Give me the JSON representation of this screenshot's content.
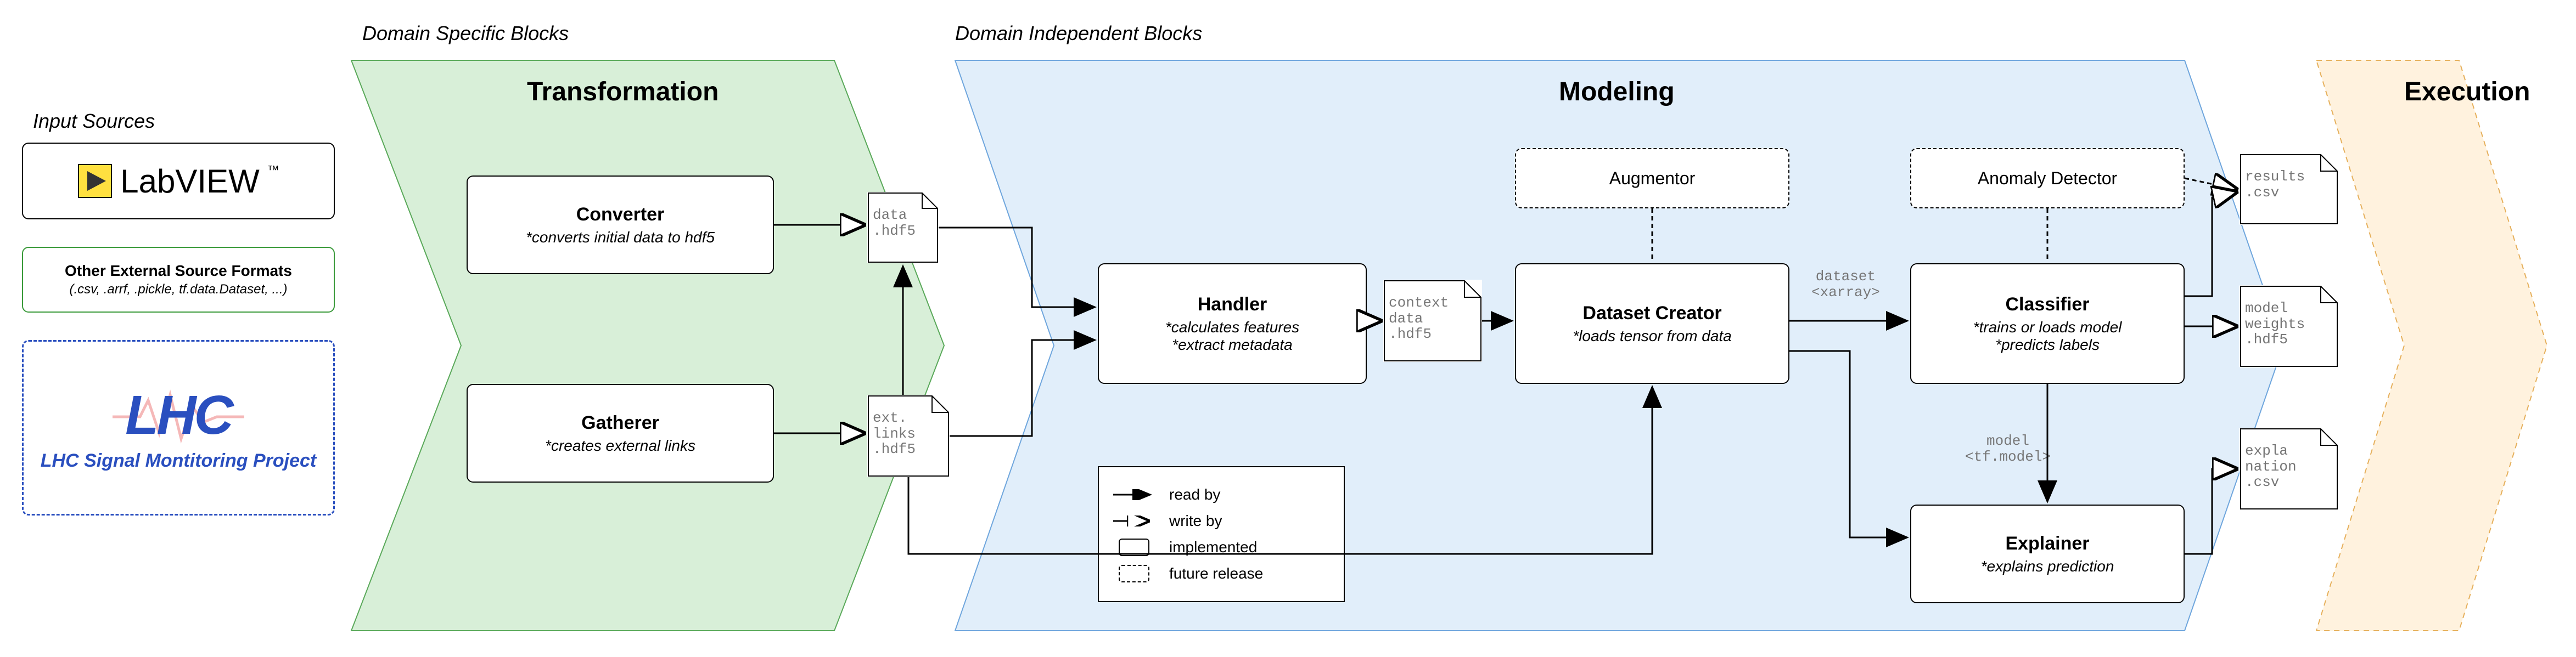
{
  "labels": {
    "input_sources": "Input Sources",
    "domain_specific": "Domain Specific Blocks",
    "domain_independent": "Domain Independent Blocks"
  },
  "sections": {
    "transformation": "Transformation",
    "modeling": "Modeling",
    "execution": "Execution"
  },
  "inputs": {
    "labview": "LabVIEW",
    "other_formats_title": "Other External Source Formats",
    "other_formats_list": "(.csv, .arrf, .pickle, tf.data.Dataset, ...)",
    "lhc_title": "LHC",
    "lhc_project": "LHC Signal Montitoring Project"
  },
  "blocks": {
    "converter": {
      "title": "Converter",
      "desc": "*converts initial data to hdf5"
    },
    "gatherer": {
      "title": "Gatherer",
      "desc": "*creates external links"
    },
    "handler": {
      "title": "Handler",
      "desc1": "*calculates features",
      "desc2": "*extract metadata"
    },
    "augmentor": {
      "title": "Augmentor"
    },
    "dataset_creator": {
      "title": "Dataset Creator",
      "desc": "*loads tensor from data"
    },
    "anomaly_detector": {
      "title": "Anomaly Detector"
    },
    "classifier": {
      "title": "Classifier",
      "desc1": "*trains or loads model",
      "desc2": "*predicts labels"
    },
    "explainer": {
      "title": "Explainer",
      "desc": "*explains prediction"
    }
  },
  "files": {
    "data_hdf5_l1": "data",
    "data_hdf5_l2": ".hdf5",
    "ext_links_l1": "ext.",
    "ext_links_l2": "links",
    "ext_links_l3": ".hdf5",
    "context_l1": "context",
    "context_l2": "data",
    "context_l3": ".hdf5",
    "results_l1": "results",
    "results_l2": ".csv",
    "weights_l1": "model",
    "weights_l2": "weights",
    "weights_l3": ".hdf5",
    "expl_l1": "expla",
    "expl_l2": "nation",
    "expl_l3": ".csv"
  },
  "edge_labels": {
    "dataset_l1": "dataset",
    "dataset_l2": "<xarray>",
    "model_l1": "model",
    "model_l2": "<tf.model>"
  },
  "legend": {
    "read_by": "read by",
    "write_by": "write by",
    "implemented": "implemented",
    "future": "future release"
  }
}
